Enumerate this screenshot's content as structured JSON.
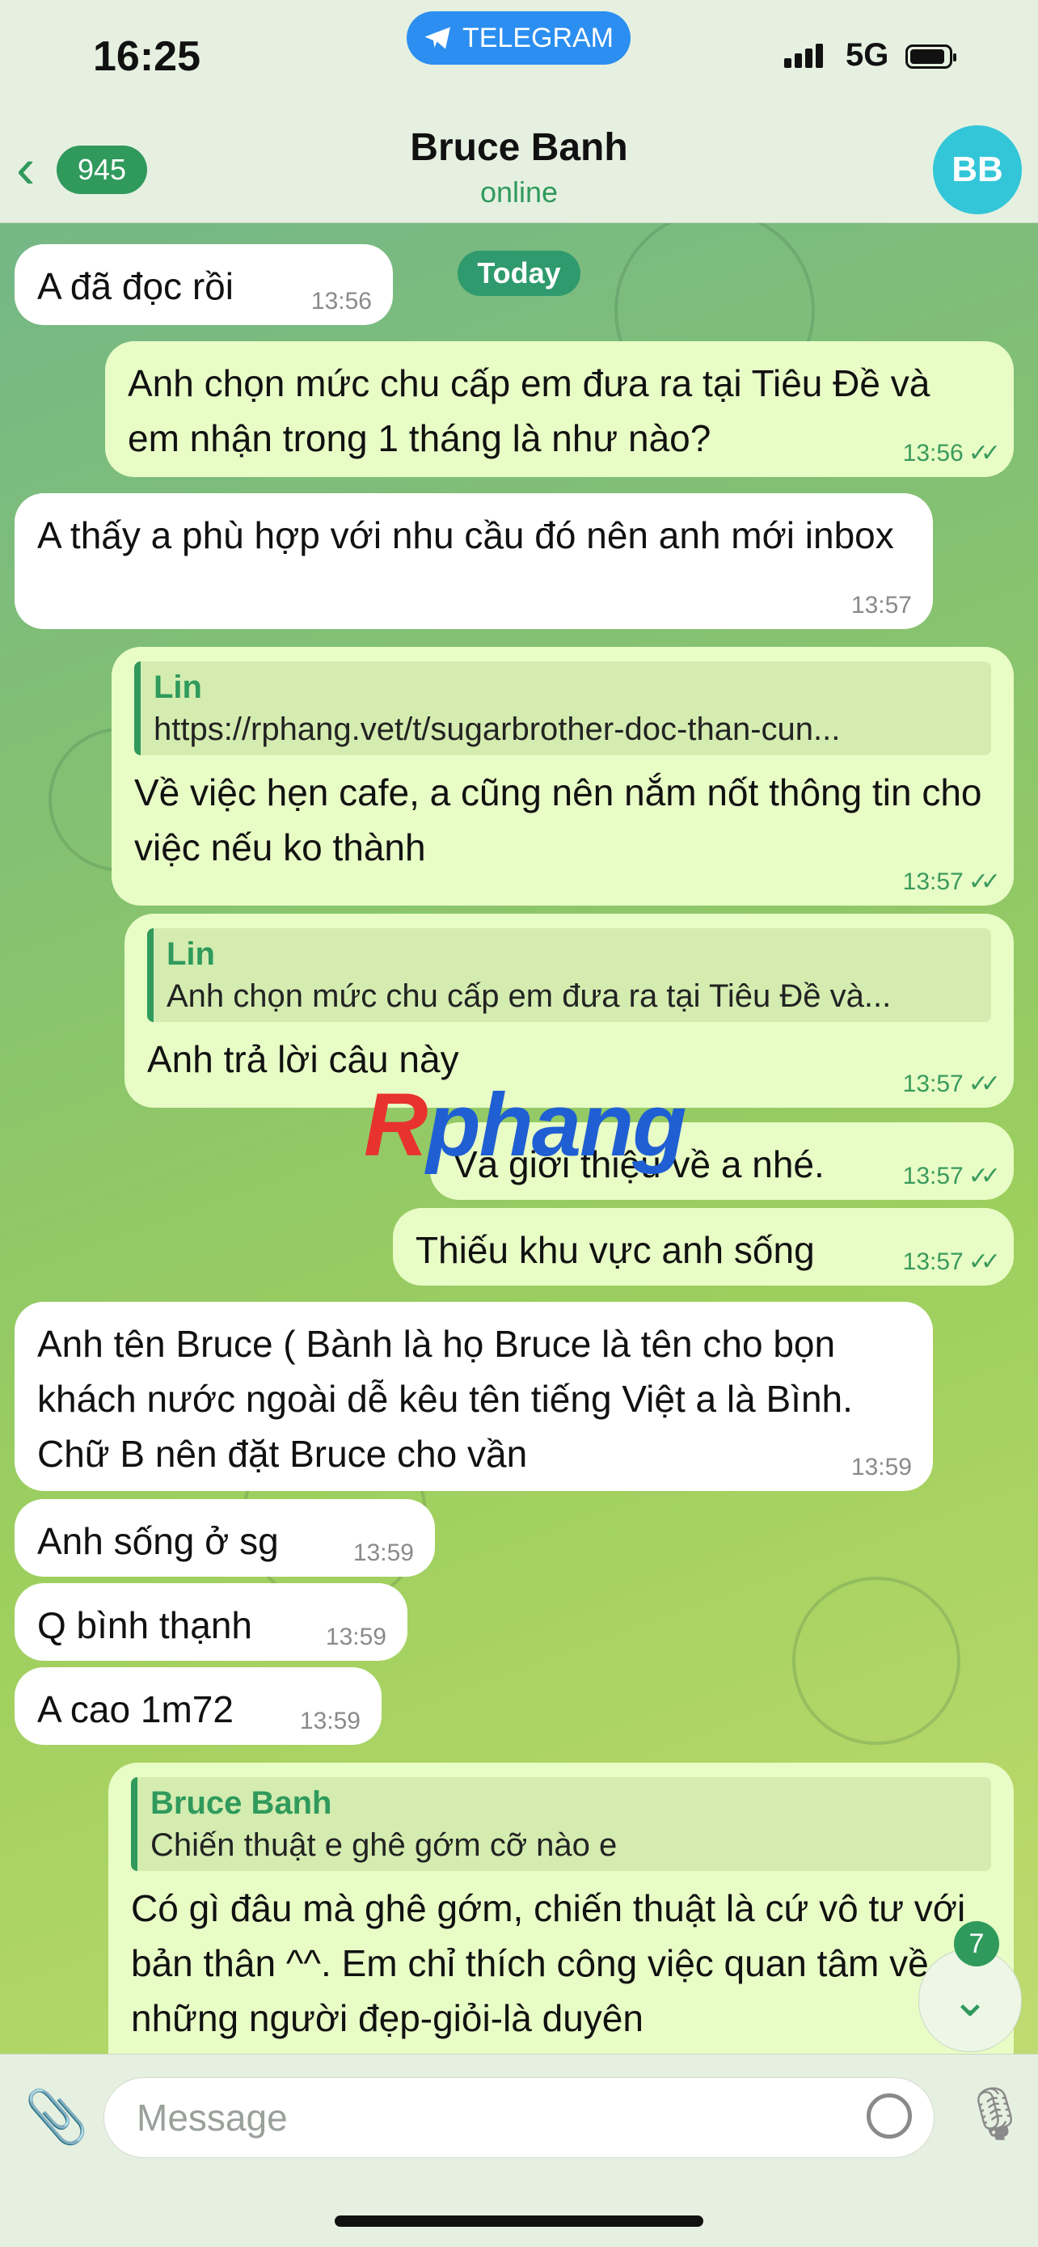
{
  "status": {
    "time": "16:25",
    "app_pill": "TELEGRAM",
    "network": "5G"
  },
  "header": {
    "back_count": "945",
    "name": "Bruce Banh",
    "status": "online",
    "avatar_initials": "BB"
  },
  "date_label": "Today",
  "messages": [
    {
      "dir": "in",
      "text": "A đã đọc rồi",
      "time": "13:56"
    },
    {
      "dir": "out",
      "text": "Anh chọn mức chu cấp em đưa ra tại Tiêu Đề và em nhận trong 1 tháng là như nào?",
      "time": "13:56"
    },
    {
      "dir": "in",
      "text": "A thấy a phù hợp với nhu cầu đó nên anh mới inbox",
      "time": "13:57"
    },
    {
      "dir": "out",
      "reply_name": "Lin",
      "reply_text": "https://rphang.vet/t/sugarbrother-doc-than-cun...",
      "text": "Về việc hẹn cafe, a cũng nên nắm nốt thông tin cho việc nếu ko thành",
      "time": "13:57"
    },
    {
      "dir": "out",
      "reply_name": "Lin",
      "reply_text": "Anh chọn mức chu cấp em đưa ra tại Tiêu Đề và...",
      "text": "Anh trả lời câu này",
      "time": "13:57"
    },
    {
      "dir": "out",
      "text": "Và giới thiệu về a nhé.",
      "time": "13:57"
    },
    {
      "dir": "out",
      "text": "Thiếu khu vực anh sống",
      "time": "13:57"
    },
    {
      "dir": "in",
      "text": "Anh tên Bruce ( Bành là họ Bruce là tên cho bọn khách nước ngoài dễ kêu tên tiếng Việt a là Bình. Chữ B nên đặt Bruce cho vần",
      "time": "13:59"
    },
    {
      "dir": "in",
      "text": "Anh sống ở sg",
      "time": "13:59"
    },
    {
      "dir": "in",
      "text": "Q bình thạnh",
      "time": "13:59"
    },
    {
      "dir": "in",
      "text": "A cao 1m72",
      "time": "13:59"
    },
    {
      "dir": "out",
      "reply_name": "Bruce Banh",
      "reply_text": "Chiến thuật e ghê gớm cỡ nào e",
      "text": "Có gì đâu mà ghê gớm, chiến thuật là cứ vô tư với bản thân ^^. Em chỉ thích công việc quan tâm về những người đẹp-giỏi-là duyên",
      "time": ""
    }
  ],
  "watermark": {
    "r": "R",
    "rest": "phang"
  },
  "scroll": {
    "count": "7"
  },
  "composer": {
    "placeholder": "Message"
  },
  "colors": {
    "accent": "#2f9a5c",
    "outgoing_bubble": "#e8fcc6",
    "incoming_bubble": "#ffffff",
    "telegram_blue": "#2b8ef0"
  }
}
